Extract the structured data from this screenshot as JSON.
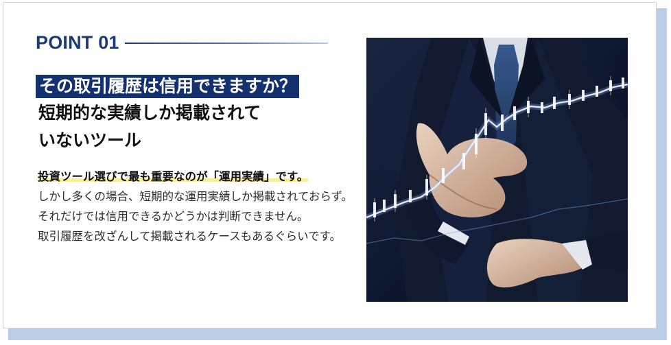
{
  "section": {
    "point_label": "POINT 01",
    "headline_highlight": "その取引履歴は信用できますか？",
    "headline_line_1": "短期的な実績しか掲載されて",
    "headline_line_2": "いないツール"
  },
  "body": {
    "lead": "投資ツール選びで最も重要なのが「運用実績」です。",
    "paragraph_1": "しかし多くの場合、短期的な運用実績しか掲載されておらず。それだけでは信用できるかどうかは判断できません。",
    "paragraph_2": "取引履歴を改ざんして掲載されるケースもあるぐらいです。"
  },
  "colors": {
    "brand_navy": "#13306f",
    "point_blue": "#1b3a78",
    "highlight_yellow": "#fbf08a",
    "shadow_blue": "#bccde8"
  },
  "image": {
    "icon": "businessman-stock-chart-photo"
  }
}
